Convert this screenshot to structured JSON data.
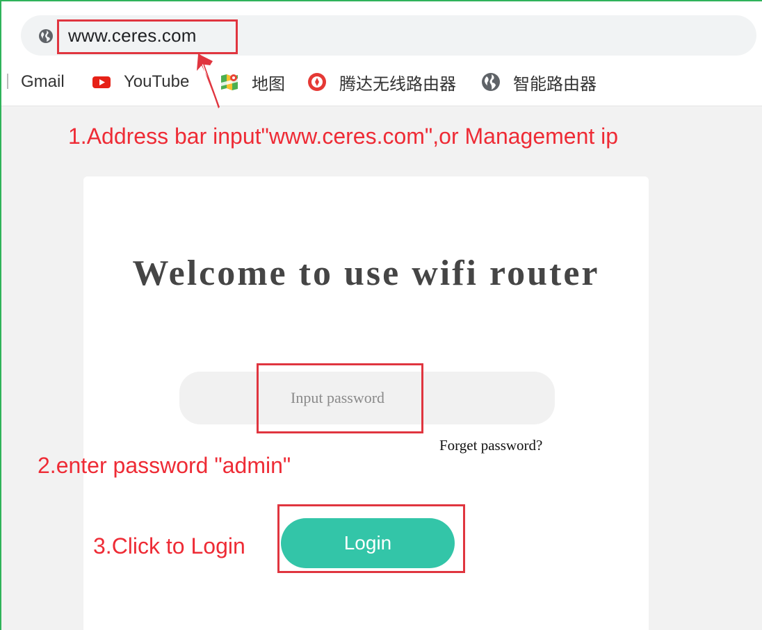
{
  "browser": {
    "address_bar": {
      "url": "www.ceres.com",
      "icon": "globe-icon"
    },
    "bookmarks": [
      {
        "label": "Gmail",
        "icon": "none"
      },
      {
        "label": "YouTube",
        "icon": "youtube-icon"
      },
      {
        "label": "地图",
        "icon": "maps-icon"
      },
      {
        "label": "腾达无线路由器",
        "icon": "tenda-icon"
      },
      {
        "label": "智能路由器",
        "icon": "globe-icon"
      }
    ]
  },
  "login": {
    "welcome_title": "Welcome to use wifi router",
    "password_placeholder": "Input password",
    "forget_link": "Forget password?",
    "login_button": "Login"
  },
  "annotations": {
    "step1": "1.Address bar input\"www.ceres.com\",or Management ip",
    "step2": "2.enter password \"admin\"",
    "step3": "3.Click to Login"
  },
  "colors": {
    "annotation_red": "#ee2b35",
    "login_button": "#33c5a8",
    "frame_border": "#2fb35a",
    "youtube_red": "#e62117"
  }
}
